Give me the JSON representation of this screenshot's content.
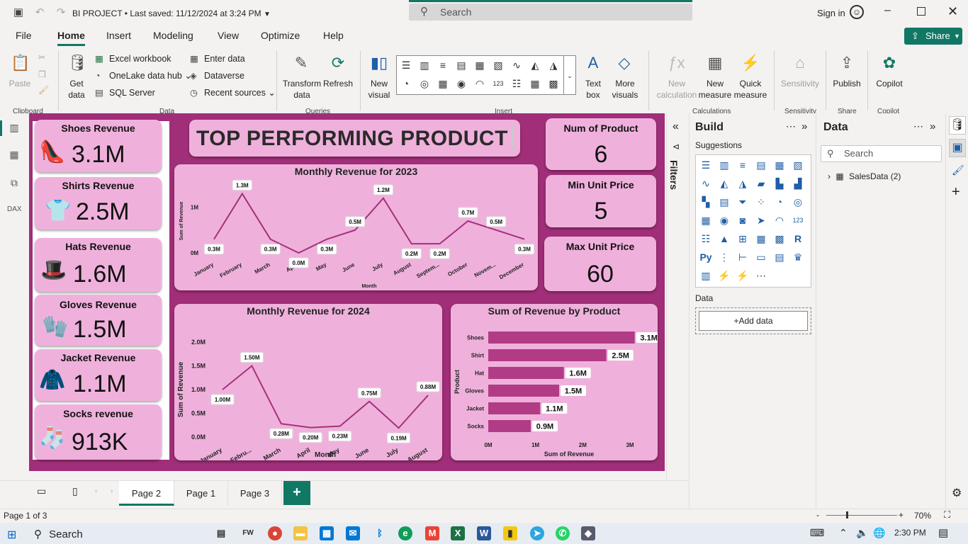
{
  "title_bar": {
    "doc_title": "BI PROJECT",
    "last_saved": "Last saved: 11/12/2024 at 3:24 PM",
    "search_placeholder": "Search",
    "sign_in": "Sign in"
  },
  "menu": {
    "items": [
      "File",
      "Home",
      "Insert",
      "Modeling",
      "View",
      "Optimize",
      "Help"
    ],
    "active": "Home",
    "share": "Share"
  },
  "ribbon": {
    "paste": "Paste",
    "get_data": [
      "Get",
      "data"
    ],
    "excel": "Excel workbook",
    "onelake": "OneLake data hub",
    "sql": "SQL Server",
    "enter_data": "Enter data",
    "dataverse": "Dataverse",
    "recent": "Recent sources",
    "transform": [
      "Transform",
      "data"
    ],
    "refresh": "Refresh",
    "new_visual": [
      "New",
      "visual"
    ],
    "text_box": [
      "Text",
      "box"
    ],
    "more_visuals": [
      "More",
      "visuals"
    ],
    "new_calc": [
      "New",
      "calculation"
    ],
    "new_measure": [
      "New",
      "measure"
    ],
    "quick_measure": [
      "Quick",
      "measure"
    ],
    "sensitivity": "Sensitivity",
    "publish": "Publish",
    "copilot": "Copilot",
    "groups": [
      "Clipboard",
      "Data",
      "Queries",
      "Insert",
      "Calculations",
      "Sensitivity",
      "Share",
      "Copilot"
    ]
  },
  "report": {
    "title": "TOP PERFORMING PRODUCT",
    "kpis_left": [
      {
        "label": "Shoes Revenue",
        "value": "3.1M",
        "icon": "high-heels-icon"
      },
      {
        "label": "Shirts Revenue",
        "value": "2.5M",
        "icon": "tshirt-icon"
      },
      {
        "label": "Hats Revenue",
        "value": "1.6M",
        "icon": "top-hat-icon"
      },
      {
        "label": "Gloves Revenue",
        "value": "1.5M",
        "icon": "gloves-icon"
      },
      {
        "label": "Jacket Revenue",
        "value": "1.1M",
        "icon": "jacket-icon"
      },
      {
        "label": "Socks revenue",
        "value": "913K",
        "icon": "socks-icon"
      }
    ],
    "kpis_right": [
      {
        "label": "Num of Product",
        "value": "6"
      },
      {
        "label": "Min Unit Price",
        "value": "5"
      },
      {
        "label": "Max Unit Price",
        "value": "60"
      }
    ]
  },
  "chart_data": [
    {
      "type": "line",
      "title": "Monthly Revenue for 2023",
      "xlabel": "Month",
      "ylabel": "Sum of Revenue",
      "x": [
        "January",
        "February",
        "March",
        "April",
        "May",
        "June",
        "July",
        "August",
        "Septem...",
        "October",
        "Novem...",
        "December"
      ],
      "values": [
        0.3,
        1.3,
        0.3,
        0.0,
        0.3,
        0.5,
        1.2,
        0.2,
        0.2,
        0.7,
        0.5,
        0.3
      ],
      "data_labels": [
        "0.3M",
        "1.3M",
        "0.3M",
        "0.0M",
        "0.3M",
        "0.5M",
        "1.2M",
        "0.2M",
        "0.2M",
        "0.7M",
        "0.5M",
        "0.3M"
      ],
      "yticks": [
        "0M",
        "1M"
      ],
      "ylim": [
        0,
        1.4
      ]
    },
    {
      "type": "line",
      "title": "Monthly Revenue for 2024",
      "xlabel": "Month",
      "ylabel": "Sum of Revenue",
      "x": [
        "January",
        "Febru...",
        "March",
        "April",
        "May",
        "June",
        "July",
        "August"
      ],
      "values": [
        1.0,
        1.5,
        0.28,
        0.2,
        0.23,
        0.75,
        0.19,
        0.88
      ],
      "data_labels": [
        "1.00M",
        "1.50M",
        "0.28M",
        "0.20M",
        "0.23M",
        "0.75M",
        "0.19M",
        "0.88M"
      ],
      "yticks": [
        "0.0M",
        "0.5M",
        "1.0M",
        "1.5M",
        "2.0M"
      ],
      "ylim": [
        0,
        2.0
      ]
    },
    {
      "type": "bar",
      "orientation": "horizontal",
      "title": "Sum of Revenue by Product",
      "xlabel": "Sum of Revenue",
      "ylabel": "Product",
      "categories": [
        "Shoes",
        "Shirt",
        "Hat",
        "Gloves",
        "Jacket",
        "Socks"
      ],
      "values": [
        3.1,
        2.5,
        1.6,
        1.5,
        1.1,
        0.9
      ],
      "data_labels": [
        "3.1M",
        "2.5M",
        "1.6M",
        "1.5M",
        "1.1M",
        "0.9M"
      ],
      "xticks": [
        "0M",
        "1M",
        "2M",
        "3M"
      ],
      "xlim": [
        0,
        3
      ]
    }
  ],
  "colors": {
    "canvas": "#a02e78",
    "card": "#efb1dc",
    "line": "#a5307c",
    "bar": "#b23b86",
    "accent": "#117865"
  },
  "filters_label": "Filters",
  "build": {
    "title": "Build",
    "suggestions": "Suggestions",
    "data_label": "Data",
    "add_data": "+Add data"
  },
  "data_pane": {
    "title": "Data",
    "search_placeholder": "Search",
    "table": "SalesData (2)"
  },
  "pages": {
    "tabs": [
      "Page 2",
      "Page 1",
      "Page 3"
    ],
    "active": "Page 2"
  },
  "status": {
    "page": "Page 1 of 3",
    "zoom": "70%"
  },
  "taskbar": {
    "search": "Search",
    "time": "2:30 PM"
  }
}
